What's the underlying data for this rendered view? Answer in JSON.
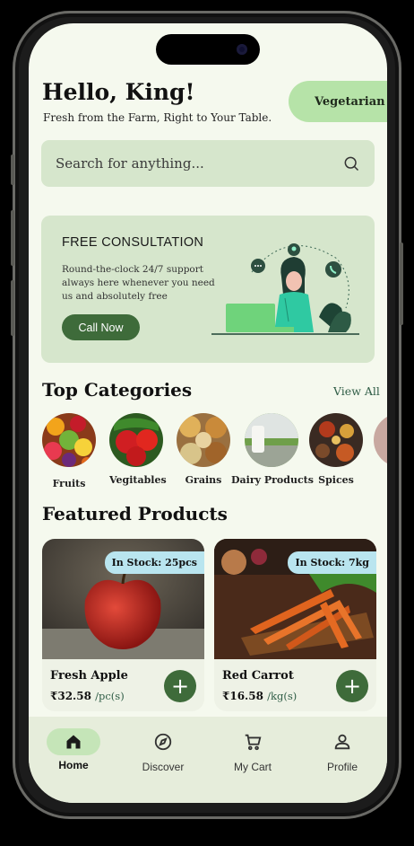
{
  "header": {
    "greeting": "Hello, King!",
    "tagline": "Fresh from the Farm, Right to Your Table.",
    "diet_badge": "Vegetarian"
  },
  "search": {
    "placeholder": "Search for anything..."
  },
  "consultation": {
    "title": "FREE CONSULTATION",
    "description": "Round-the-clock 24/7 support always here whenever you need us and absolutely free",
    "button": "Call Now"
  },
  "categories": {
    "title": "Top Categories",
    "view_all": "View All",
    "items": [
      {
        "label": "Fruits"
      },
      {
        "label": "Vegitables"
      },
      {
        "label": "Grains"
      },
      {
        "label": "Dairy Products"
      },
      {
        "label": "Spices"
      }
    ]
  },
  "featured": {
    "title": "Featured Products",
    "products": [
      {
        "name": "Fresh Apple",
        "price": "₹32.58",
        "unit": "/pc(s)",
        "stock": "In Stock: 25pcs"
      },
      {
        "name": "Red Carrot",
        "price": "₹16.58",
        "unit": "/kg(s)",
        "stock": "In Stock: 7kg"
      }
    ]
  },
  "nav": {
    "items": [
      {
        "label": "Home",
        "icon": "home-icon",
        "active": true
      },
      {
        "label": "Discover",
        "icon": "compass-icon"
      },
      {
        "label": "My Cart",
        "icon": "cart-icon"
      },
      {
        "label": "Profile",
        "icon": "user-icon"
      }
    ]
  },
  "colors": {
    "background": "#f5f9ee",
    "card": "#d6e6cc",
    "accent": "#3e6b3a",
    "pill": "#b6e3a8",
    "stock_badge": "#b9e5ef"
  }
}
